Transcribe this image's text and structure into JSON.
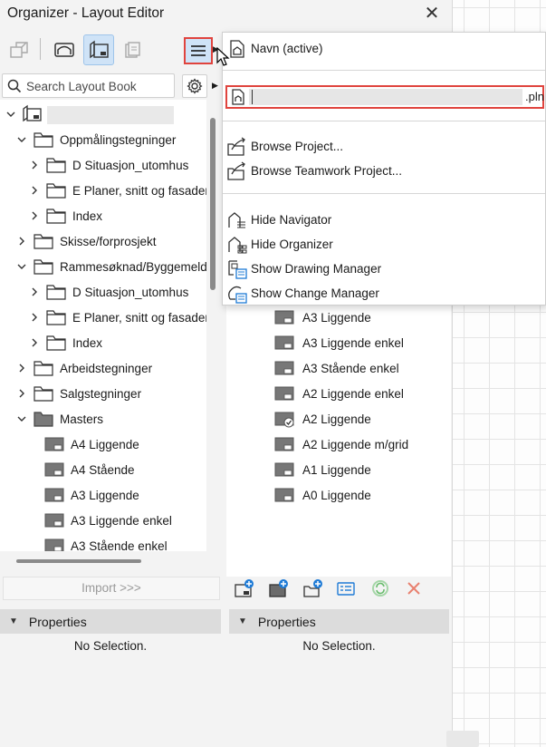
{
  "window": {
    "title": "Organizer - Layout Editor",
    "close_glyph": "✕"
  },
  "toolbar": {
    "icons": [
      "publisher-sets-icon",
      "view-map-icon",
      "layout-book-icon",
      "publisher-icon"
    ],
    "menu_icon": "hamburger-menu-icon"
  },
  "search": {
    "placeholder": "Search Layout Book"
  },
  "tree": {
    "root_label": "",
    "items": [
      {
        "label": "Oppmålingstegninger",
        "level": 1,
        "expanded": true,
        "type": "folder"
      },
      {
        "label": "D Situasjon_utomhus",
        "level": 2,
        "expanded": false,
        "type": "folder"
      },
      {
        "label": "E Planer, snitt og fasader",
        "level": 2,
        "expanded": false,
        "type": "folder"
      },
      {
        "label": "Index",
        "level": 2,
        "expanded": false,
        "type": "folder"
      },
      {
        "label": "Skisse/forprosjekt",
        "level": 1,
        "expanded": false,
        "type": "folder"
      },
      {
        "label": "Rammesøknad/Byggemelding",
        "level": 1,
        "expanded": true,
        "type": "folder"
      },
      {
        "label": "D Situasjon_utomhus",
        "level": 2,
        "expanded": false,
        "type": "folder"
      },
      {
        "label": "E Planer, snitt og fasader",
        "level": 2,
        "expanded": false,
        "type": "folder"
      },
      {
        "label": "Index",
        "level": 2,
        "expanded": false,
        "type": "folder"
      },
      {
        "label": "Arbeidstegninger",
        "level": 1,
        "expanded": false,
        "type": "folder"
      },
      {
        "label": "Salgstegninger",
        "level": 1,
        "expanded": false,
        "type": "folder"
      },
      {
        "label": "Masters",
        "level": 1,
        "expanded": true,
        "type": "folder-dark"
      },
      {
        "label": "A4 Liggende",
        "level": 2,
        "type": "master"
      },
      {
        "label": "A4 Stående",
        "level": 2,
        "type": "master"
      },
      {
        "label": "A3 Liggende",
        "level": 2,
        "type": "master"
      },
      {
        "label": "A3 Liggende enkel",
        "level": 2,
        "type": "master"
      },
      {
        "label": "A3 Stående enkel",
        "level": 2,
        "type": "master"
      }
    ]
  },
  "right_list": {
    "items": [
      {
        "label": "A3 Liggende",
        "icon": "master-layout-icon"
      },
      {
        "label": "A3 Liggende enkel",
        "icon": "master-layout-icon"
      },
      {
        "label": "A3 Stående enkel",
        "icon": "master-layout-icon"
      },
      {
        "label": "A2 Liggende enkel",
        "icon": "master-layout-icon"
      },
      {
        "label": "A2 Liggende",
        "icon": "master-layout-check-icon"
      },
      {
        "label": "A2 Liggende m/grid",
        "icon": "master-layout-icon"
      },
      {
        "label": "A1 Liggende",
        "icon": "master-layout-icon"
      },
      {
        "label": "A0 Liggende",
        "icon": "master-layout-icon"
      }
    ]
  },
  "left_bottom": {
    "import_label": "Import >>>",
    "properties_label": "Properties",
    "no_selection": "No Selection."
  },
  "right_bottom": {
    "properties_label": "Properties",
    "no_selection": "No Selection.",
    "tools": [
      "new-layout-icon",
      "new-master-icon",
      "new-subset-icon",
      "layout-settings-icon",
      "update-icon",
      "delete-icon"
    ]
  },
  "dropdown": {
    "active_item": "Navn (active)",
    "file_ext": ".pln",
    "browse_project": "Browse Project...",
    "browse_teamwork": "Browse Teamwork Project...",
    "hide_navigator": "Hide Navigator",
    "hide_organizer": "Hide Organizer",
    "show_drawing_manager": "Show Drawing Manager",
    "show_change_manager": "Show Change Manager"
  },
  "colors": {
    "highlight_red": "#e0443e",
    "active_blue": "#cfe3f7",
    "delete_red": "#e05a4e",
    "update_green": "#4caf50"
  }
}
